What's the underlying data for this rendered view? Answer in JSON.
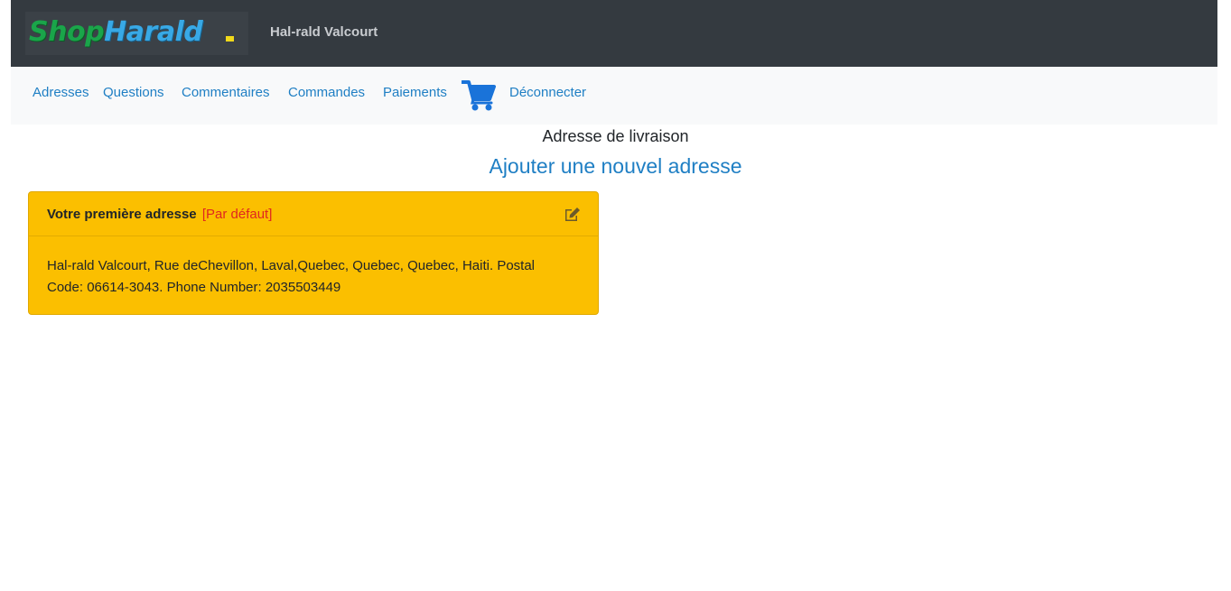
{
  "brand": {
    "logo_shop": "Shop",
    "logo_harald": "Harald",
    "accent_color": "#1aa54a"
  },
  "header": {
    "user_name": "Hal-rald Valcourt"
  },
  "nav": {
    "items": [
      {
        "label": "Adresses"
      },
      {
        "label": "Questions"
      },
      {
        "label": "Commentaires"
      },
      {
        "label": "Commandes"
      },
      {
        "label": "Paiements"
      }
    ],
    "cart_icon": "shopping-cart-icon",
    "logout_label": "Déconnecter",
    "link_color": "#1f7fc4"
  },
  "main": {
    "heading": "Adresse de livraison",
    "add_address_label": "Ajouter une nouvel adresse"
  },
  "address_card": {
    "title": "Votre première adresse",
    "default_badge": "[Par défaut]",
    "edit_icon": "edit-icon",
    "details": "Hal-rald Valcourt, Rue deChevillon, Laval,Quebec, Quebec, Quebec, Haiti. Postal Code: 06614-3043. Phone Number: 2035503449",
    "background_color": "#fbbf00"
  }
}
